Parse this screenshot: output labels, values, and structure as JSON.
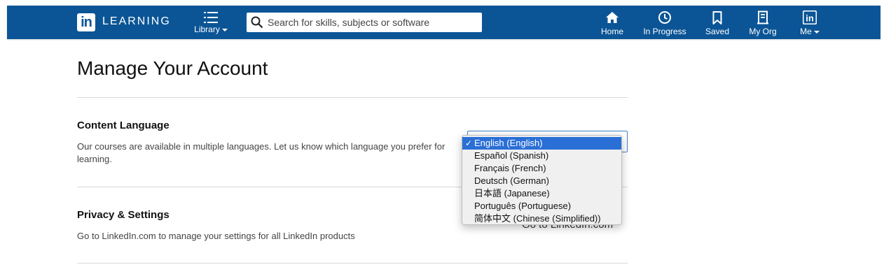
{
  "header": {
    "logo_text": "in",
    "brand": "LEARNING",
    "library_label": "Library",
    "search_placeholder": "Search for skills, subjects or software",
    "nav": [
      {
        "label": "Home",
        "icon": "home-icon"
      },
      {
        "label": "In Progress",
        "icon": "clock-icon"
      },
      {
        "label": "Saved",
        "icon": "bookmark-icon"
      },
      {
        "label": "My Org",
        "icon": "building-icon"
      },
      {
        "label": "Me",
        "icon": "linkedin-avatar-icon"
      }
    ]
  },
  "page": {
    "title": "Manage Your Account"
  },
  "content_language": {
    "title": "Content Language",
    "description": "Our courses are available in multiple languages. Let us know which language you prefer for learning.",
    "selected": "English (English)",
    "options": [
      "English (English)",
      "Español (Spanish)",
      "Français (French)",
      "Deutsch (German)",
      "日本語 (Japanese)",
      "Português (Portuguese)",
      "简体中文 (Chinese (Simplified))"
    ]
  },
  "privacy": {
    "title": "Privacy & Settings",
    "description": "Go to LinkedIn.com to manage your settings for all LinkedIn products",
    "link": "Go to LinkedIn.com"
  },
  "colors": {
    "nav_bg": "#0b5596",
    "selection": "#2a6fd6"
  }
}
